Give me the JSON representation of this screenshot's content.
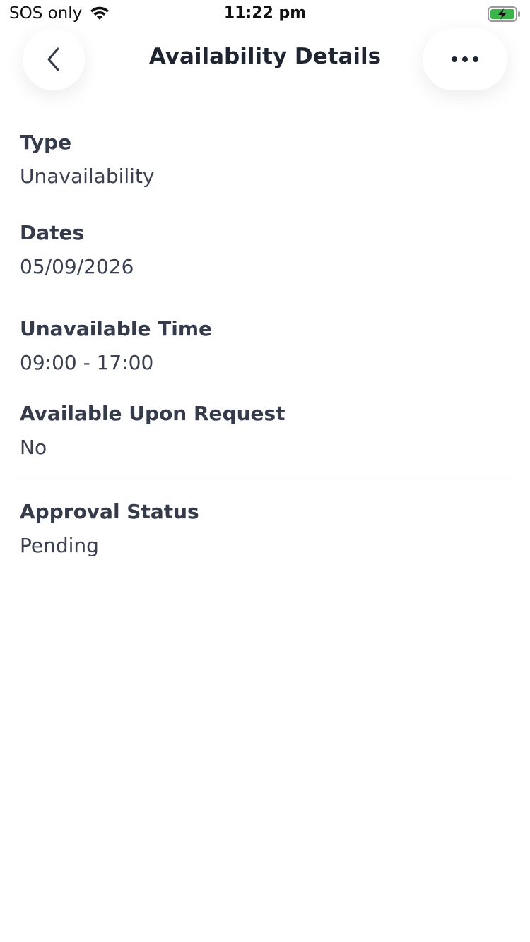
{
  "status_bar": {
    "carrier": "SOS only",
    "time": "11:22 pm",
    "battery_color": "#3ab54a"
  },
  "nav": {
    "title": "Availability Details",
    "back_icon": "chevron-left-icon",
    "more_icon": "ellipsis-icon"
  },
  "fields": {
    "type": {
      "label": "Type",
      "value": "Unavailability"
    },
    "dates": {
      "label": "Dates",
      "value": "05/09/2026"
    },
    "unavailable_time": {
      "label": "Unavailable Time",
      "value": "09:00 - 17:00"
    },
    "available_upon_request": {
      "label": "Available Upon Request",
      "value": "No"
    },
    "approval_status": {
      "label": "Approval Status",
      "value": "Pending"
    }
  }
}
